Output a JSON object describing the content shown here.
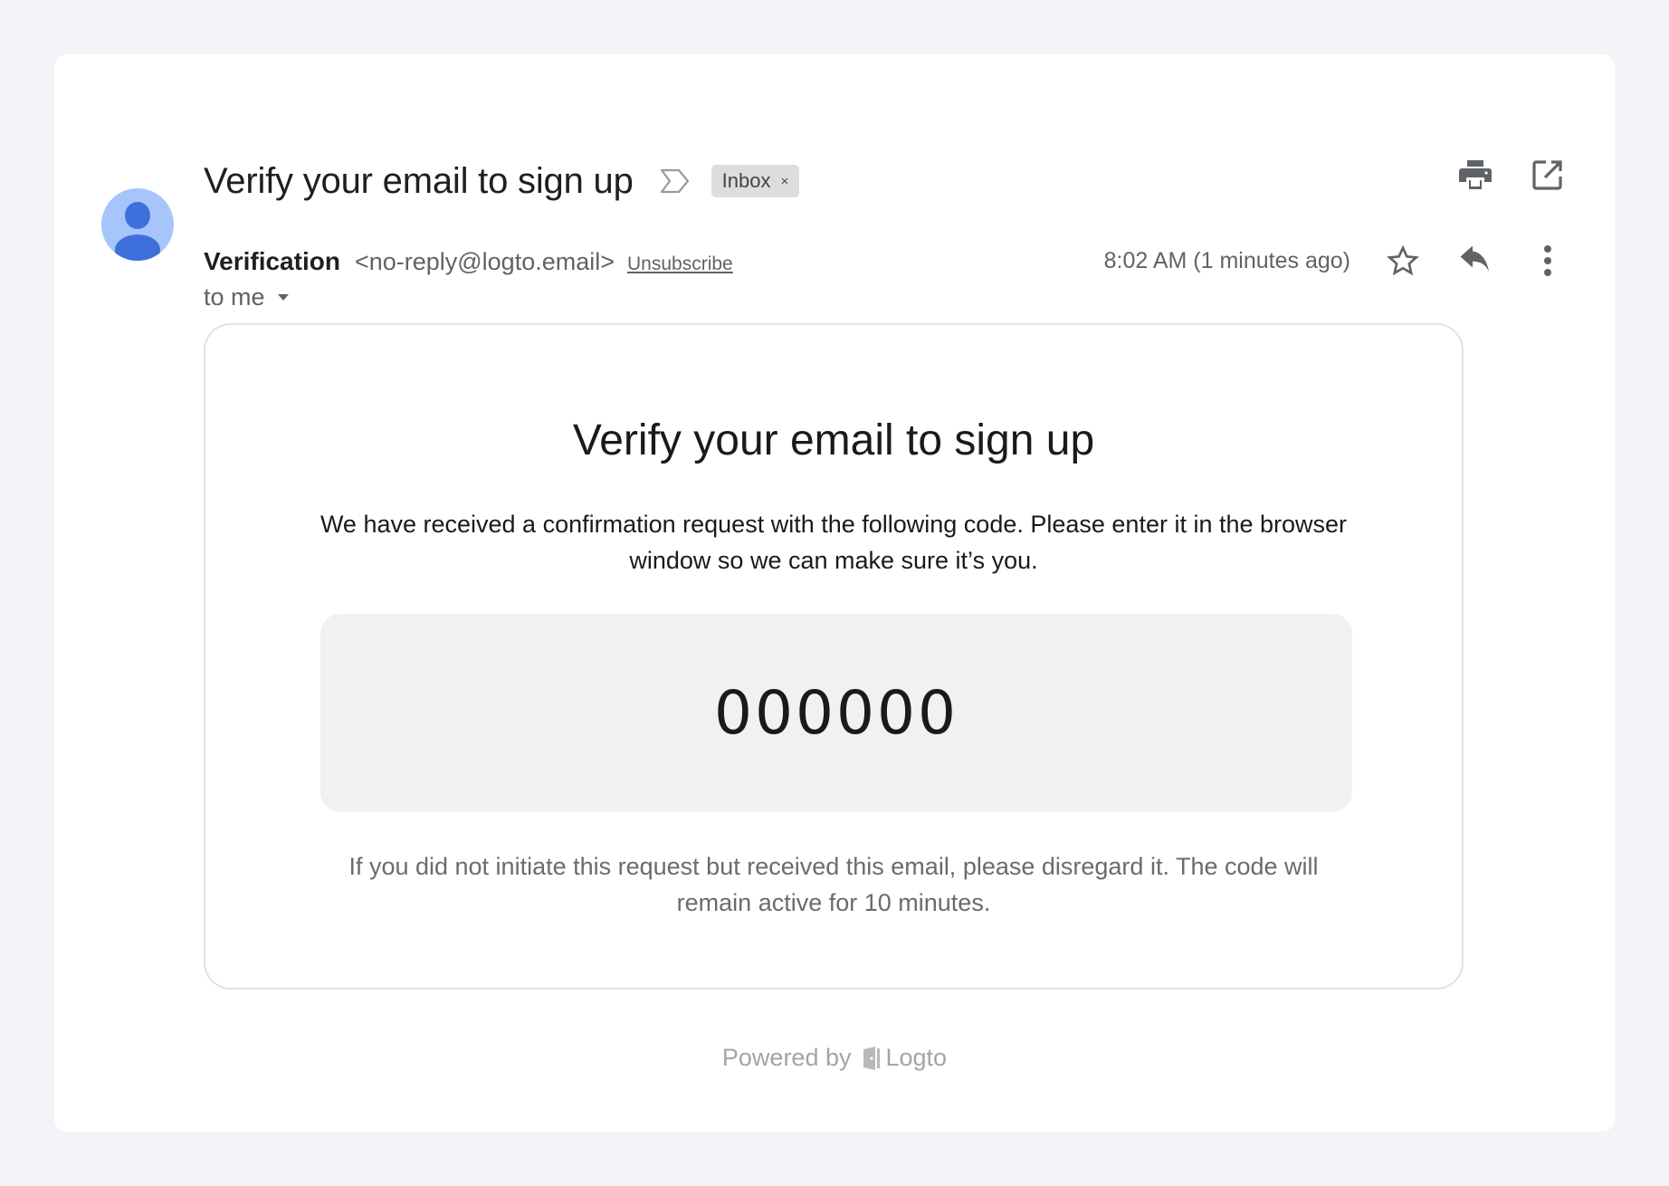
{
  "email": {
    "subject": "Verify your email to sign up",
    "label": "Inbox",
    "label_remove": "×",
    "sender_name": "Verification",
    "sender_email": "<no-reply@logto.email>",
    "unsubscribe": "Unsubscribe",
    "recipient": "to me",
    "timestamp": "8:02 AM (1 minutes ago)"
  },
  "icons": {
    "importance": "importance-marker-icon",
    "print": "print-icon",
    "open_new": "open-in-new-window-icon",
    "star": "star-icon",
    "reply": "reply-icon",
    "more": "more-vertical-icon",
    "avatar": "person-avatar-icon",
    "logo": "logto-logo-icon"
  },
  "body": {
    "title": "Verify your email to sign up",
    "paragraph": "We have received a confirmation request with the following code. Please enter it in the browser window so we can make sure it’s you.",
    "code": "000000",
    "disclaimer": "If you did not initiate this request but received this email, please disregard it. The code will remain active for 10 minutes."
  },
  "footer": {
    "powered_by": "Powered by",
    "brand": "Logto"
  },
  "colors": {
    "page_bg": "#f4f4f8",
    "avatar_bg": "#a6c5fb",
    "avatar_fg": "#3f6fdb",
    "code_bg": "#f0f1f1",
    "icon": "#5f6368"
  }
}
